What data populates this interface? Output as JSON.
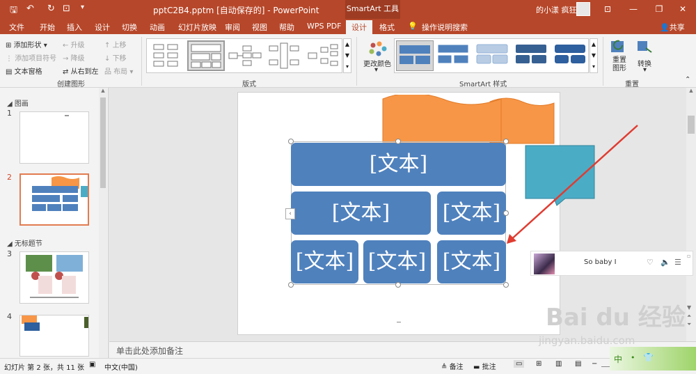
{
  "titlebar": {
    "doc_title": "pptC2B4.pptm [自动保存的] - PowerPoint",
    "context_tab": "SmartArt 工具",
    "user": "的小漾 疯狂",
    "share": "共享"
  },
  "tabs": [
    "文件",
    "开始",
    "插入",
    "设计",
    "切换",
    "动画",
    "幻灯片放映",
    "审阅",
    "视图",
    "帮助",
    "WPS PDF",
    "设计",
    "格式"
  ],
  "tellme": "操作说明搜索",
  "ribbon": {
    "create": {
      "add_shape": "添加形状",
      "add_bullet": "添加项目符号",
      "text_pane": "文本窗格",
      "promote": "升级",
      "demote": "降级",
      "rtl": "从右到左",
      "move_up": "上移",
      "move_down": "下移",
      "layout": "布局",
      "group_label": "创建图形"
    },
    "layouts_label": "版式",
    "change_colors": "更改颜色",
    "styles_label": "SmartArt 样式",
    "reset": {
      "reset_graphic": "重置\n图形",
      "convert": "转换",
      "group_label": "重置"
    }
  },
  "slides_pane": {
    "section1": "图画",
    "section2": "无标题节",
    "slide_nums": [
      "1",
      "2",
      "3",
      "4"
    ]
  },
  "smartart": {
    "texts": [
      "[文本]",
      "[文本]",
      "[文本]",
      "[文本]",
      "[文本]",
      "[文本]"
    ]
  },
  "notes": "单击此处添加备注",
  "status": {
    "slide_info": "幻灯片 第 2 张，共 11 张",
    "language": "中文(中国)",
    "notes": "备注",
    "comments": "批注"
  },
  "music": {
    "song": "So baby I"
  },
  "watermark": {
    "brand": "Bai du 经验",
    "url": "jingyan.baidu.com",
    "ime": "中"
  },
  "colors": {
    "ppt_red": "#b7472a",
    "smartart_blue": "#4f81bd",
    "orange": "#f79646",
    "teal": "#4bacc6",
    "arrow": "#e03c31"
  }
}
